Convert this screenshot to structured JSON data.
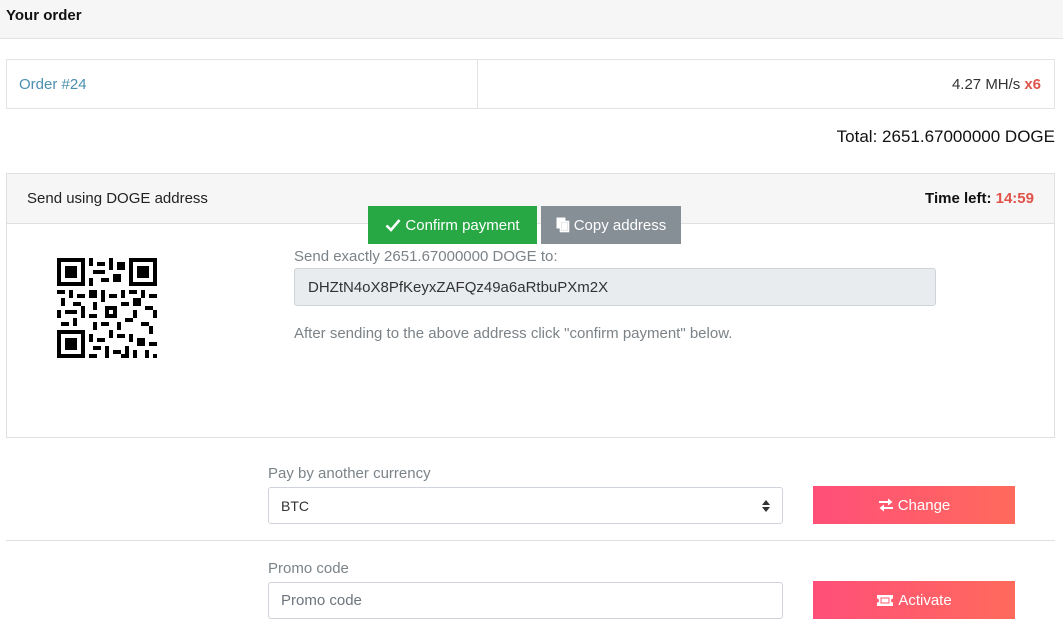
{
  "header": {
    "title": "Your order"
  },
  "order": {
    "name": "Order #24",
    "hashrate": "4.27 MH/s",
    "multiplier": "x6"
  },
  "total": {
    "label": "Total:",
    "value": "2651.67000000 DOGE"
  },
  "payment": {
    "title": "Send using DOGE address",
    "time_left_label": "Time left:",
    "time_left_value": "14:59",
    "send_label": "Send exactly 2651.67000000 DOGE to:",
    "address": "DHZtN4oX8PfKeyxZAFQz49a6aRtbuPXm2X",
    "note": "After sending to the above address click \"confirm payment\" below.",
    "confirm_label": "Confirm payment",
    "copy_label": "Copy address"
  },
  "currency": {
    "label": "Pay by another currency",
    "selected": "BTC",
    "change_label": "Change"
  },
  "promo": {
    "label": "Promo code",
    "placeholder": "Promo code",
    "value": "",
    "activate_label": "Activate"
  },
  "colors": {
    "accent_link": "#4a8fb0",
    "danger": "#e0534a",
    "success": "#28a745",
    "secondary": "#868e96",
    "gradient_start": "#ff4f79",
    "gradient_end": "#ff6a5c"
  },
  "icons": {
    "confirm": "check-icon",
    "copy": "copy-icon",
    "change": "exchange-icon",
    "activate": "ticket-icon",
    "select": "chevron-up-down-icon"
  }
}
